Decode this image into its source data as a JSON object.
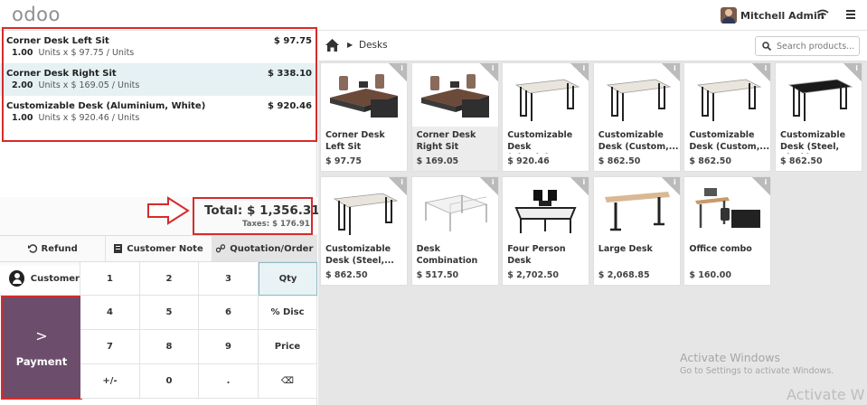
{
  "topbar": {
    "logo": "odoo",
    "user_name": "Mitchell Admin"
  },
  "order": {
    "lines": [
      {
        "name": "Corner Desk Left Sit",
        "price": "$ 97.75",
        "qty": "1.00",
        "detail": "Units x $ 97.75 / Units",
        "selected": false
      },
      {
        "name": "Corner Desk Right Sit",
        "price": "$ 338.10",
        "qty": "2.00",
        "detail": "Units x $ 169.05 / Units",
        "selected": true
      },
      {
        "name": "Customizable Desk (Aluminium, White)",
        "price": "$ 920.46",
        "qty": "1.00",
        "detail": "Units x $ 920.46 / Units",
        "selected": false
      }
    ],
    "total_label": "Total: $ 1,356.31",
    "taxes_label": "Taxes: $ 176.91"
  },
  "controls": {
    "refund": "Refund",
    "customer_note": "Customer Note",
    "quotation": "Quotation/Order"
  },
  "pad": {
    "customer": "Customer",
    "payment": "Payment",
    "keys": [
      "1",
      "2",
      "3",
      "Qty",
      "4",
      "5",
      "6",
      "% Disc",
      "7",
      "8",
      "9",
      "Price",
      "+/-",
      "0",
      ".",
      "⌫"
    ]
  },
  "products_bar": {
    "breadcrumb": "Desks",
    "search_placeholder": "Search products..."
  },
  "products": [
    {
      "name": "Corner Desk Left Sit",
      "price": "$ 97.75",
      "kind": "corner-desk-icon"
    },
    {
      "name": "Corner Desk Right Sit",
      "price": "$ 169.05",
      "kind": "corner-desk-icon"
    },
    {
      "name": "Customizable Desk (Aluminiu...",
      "price": "$ 920.46",
      "kind": "white-desk-icon"
    },
    {
      "name": "Customizable Desk (Custom,...",
      "price": "$ 862.50",
      "kind": "white-desk-icon"
    },
    {
      "name": "Customizable Desk (Custom,...",
      "price": "$ 862.50",
      "kind": "white-desk-icon"
    },
    {
      "name": "Customizable Desk (Steel, Black)",
      "price": "$ 862.50",
      "kind": "black-desk-icon"
    },
    {
      "name": "Customizable Desk (Steel,...",
      "price": "$ 862.50",
      "kind": "white-desk-icon"
    },
    {
      "name": "Desk Combination",
      "price": "$ 517.50",
      "kind": "combination-desk-icon"
    },
    {
      "name": "Four Person Desk",
      "price": "$ 2,702.50",
      "kind": "four-person-desk-icon"
    },
    {
      "name": "Large Desk",
      "price": "$ 2,068.85",
      "kind": "large-desk-icon"
    },
    {
      "name": "Office combo",
      "price": "$ 160.00",
      "kind": "office-combo-icon"
    }
  ],
  "watermark": {
    "line1": "Activate Windows",
    "line2": "Go to Settings to activate Windows.",
    "line3": "Activate W"
  },
  "colors": {
    "payment": "#6d4d6c",
    "highlight_box": "#d62b2b",
    "selected_line": "#e6f1f4"
  }
}
